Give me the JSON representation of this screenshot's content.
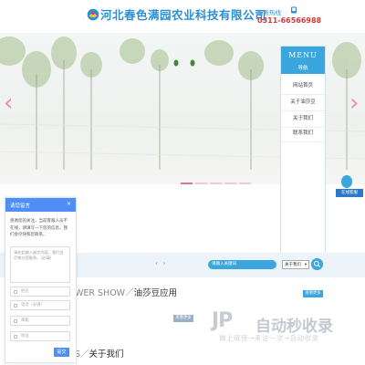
{
  "header": {
    "company_name": "河北春色满园农业科技有限公司",
    "hotline_label": "服务热线",
    "hotline_number": "0311-66566988"
  },
  "banner": {
    "prev_arrow": "‹",
    "next_arrow": "›",
    "slide_count": 5,
    "active_slide": 1
  },
  "menu": {
    "title": "MENU",
    "subtitle": "导航",
    "items": [
      {
        "label": "网站首页"
      },
      {
        "label": "关于油莎豆"
      },
      {
        "label": "关于我们"
      },
      {
        "label": "联系我们"
      }
    ]
  },
  "service": {
    "label": "在线客服"
  },
  "chat": {
    "title": "请您留言",
    "close": "×",
    "message": "感谢您的关注，当前客服人员不在线，请填写一下您的信息，我们会尽快和您联系。",
    "textarea_placeholder": "请在此输入留言内容，我们会尽快与您联系。（必填）",
    "name_placeholder": "姓名",
    "phone_placeholder": "电话（必填）",
    "email_placeholder": "邮箱",
    "address_placeholder": "地址",
    "send_label": "提交"
  },
  "search": {
    "pager_prev": "‹",
    "pager_next": "›",
    "placeholder": "请输入关键词",
    "select_value": "关于我们",
    "select_arrow": "▾"
  },
  "content": {
    "section1_prefix": "WER SHOW／",
    "section1_title": "油莎豆应用",
    "more_label": "查看更多",
    "more_label2": "查看更多",
    "section2_prefix": "S／",
    "section2_title": "关于我们"
  },
  "watermark": {
    "logo": "JP",
    "title": "自动秒收录",
    "subtitle": "做上链接→来访一次→自动收录"
  },
  "colors": {
    "brand_blue": "#3aa6dd",
    "company_blue": "#2b8fd6",
    "hotline_red": "#d23a3a",
    "banner_pink": "#f08ab4",
    "chat_blue": "#4e8ef5"
  }
}
